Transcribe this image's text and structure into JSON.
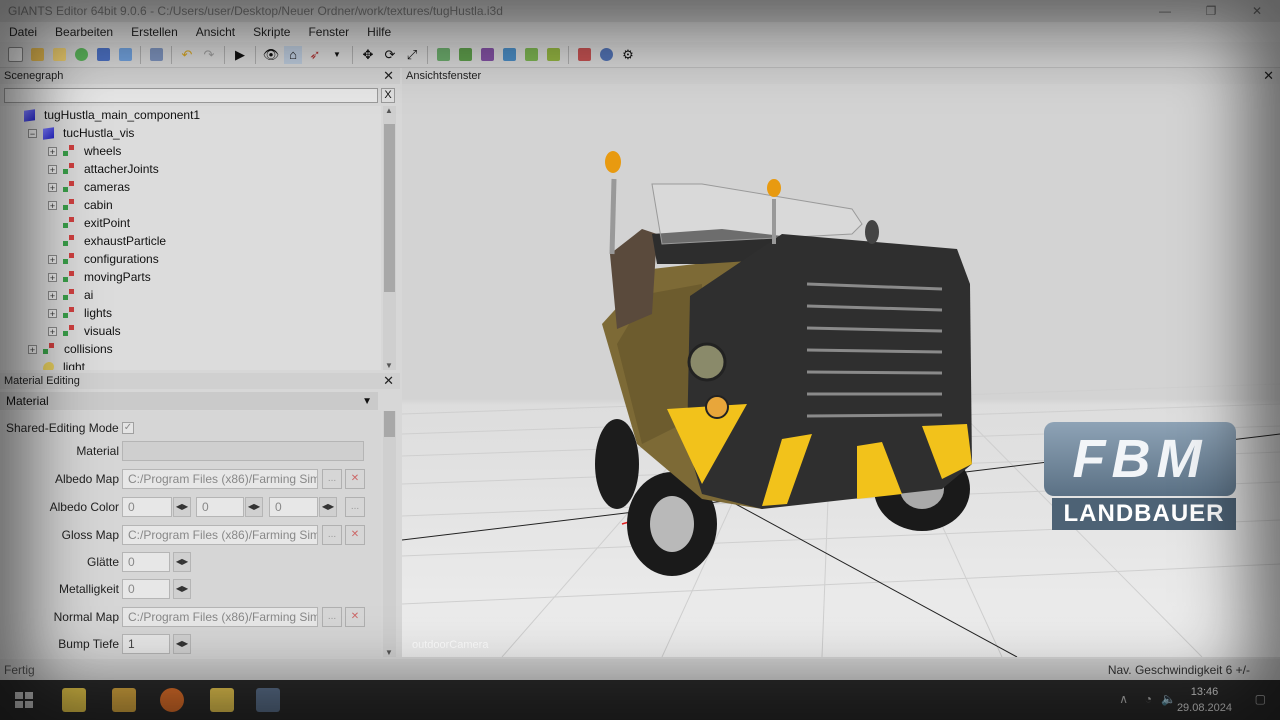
{
  "window": {
    "title": "GIANTS Editor 64bit 9.0.6 - C:/Users/user/Desktop/Neuer Ordner/work/textures/tugHustla.i3d",
    "controls": [
      "minimize",
      "restore",
      "close"
    ]
  },
  "menu": [
    "Datei",
    "Bearbeiten",
    "Erstellen",
    "Ansicht",
    "Skripte",
    "Fenster",
    "Hilfe"
  ],
  "toolbar": {
    "groups": [
      [
        "new-file-icon",
        "open-folder-icon",
        "edit-icon",
        "refresh-icon",
        "save-icon",
        "export-icon",
        "import-icon"
      ],
      [
        "undo-icon",
        "redo-icon"
      ],
      [
        "play-icon"
      ],
      [
        "eye-icon",
        "home-icon",
        "navigate-icon",
        "dropdown-icon"
      ],
      [
        "move-icon",
        "rotate-icon",
        "scale-icon"
      ],
      [
        "terrain-paint-icon",
        "terrain-sculpt-icon",
        "foliage-paint-icon",
        "foliage-erase-icon",
        "tree-icon",
        "tree-erase-icon"
      ],
      [
        "cube-icon",
        "shader-icon",
        "settings-icon"
      ]
    ]
  },
  "scenegraph": {
    "title": "Scenegraph",
    "close": "✕",
    "filter_clear": "X",
    "nodes": [
      {
        "label": "tugHustla_main_component1",
        "level": 0,
        "icon": "shape",
        "expander": ""
      },
      {
        "label": "tucHustla_vis",
        "level": 1,
        "icon": "shape",
        "expander": "−"
      },
      {
        "label": "wheels",
        "level": 2,
        "icon": "transformgroup",
        "expander": "+"
      },
      {
        "label": "attacherJoints",
        "level": 2,
        "icon": "transformgroup",
        "expander": "+"
      },
      {
        "label": "cameras",
        "level": 2,
        "icon": "transformgroup",
        "expander": "+"
      },
      {
        "label": "cabin",
        "level": 2,
        "icon": "transformgroup",
        "expander": "+"
      },
      {
        "label": "exitPoint",
        "level": 2,
        "icon": "transformgroup",
        "expander": ""
      },
      {
        "label": "exhaustParticle",
        "level": 2,
        "icon": "transformgroup",
        "expander": ""
      },
      {
        "label": "configurations",
        "level": 2,
        "icon": "transformgroup",
        "expander": "+"
      },
      {
        "label": "movingParts",
        "level": 2,
        "icon": "transformgroup",
        "expander": "+"
      },
      {
        "label": "ai",
        "level": 2,
        "icon": "transformgroup",
        "expander": "+"
      },
      {
        "label": "lights",
        "level": 2,
        "icon": "transformgroup",
        "expander": "+"
      },
      {
        "label": "visuals",
        "level": 2,
        "icon": "transformgroup",
        "expander": "+"
      },
      {
        "label": "collisions",
        "level": 1,
        "icon": "transformgroup",
        "expander": "+"
      },
      {
        "label": "light",
        "level": 1,
        "icon": "light",
        "expander": ""
      }
    ]
  },
  "material_editing": {
    "title": "Material Editing",
    "close": "✕",
    "dropdown": "Material",
    "shared_mode_label": "Shared-Editing Mode",
    "material_label": "Material",
    "albedo_map_label": "Albedo Map",
    "albedo_map_value": "C:/Program Files (x86)/Farming Sim",
    "albedo_color_label": "Albedo Color",
    "albedo_color_values": [
      "0",
      "0",
      "0"
    ],
    "gloss_map_label": "Gloss Map",
    "gloss_map_value": "C:/Program Files (x86)/Farming Sim",
    "glaette_label": "Glätte",
    "glaette_value": "0",
    "metallic_label": "Metalligkeit",
    "metallic_value": "0",
    "normal_map_label": "Normal Map",
    "normal_map_value": "C:/Program Files (x86)/Farming Sim",
    "bump_label": "Bump Tiefe",
    "bump_value": "1",
    "browse_label": "...",
    "clear_label": "✕"
  },
  "viewport": {
    "title": "Ansichtsfenster",
    "close": "✕",
    "camera": "outdoorCamera"
  },
  "logo": {
    "main": "FBM",
    "sub": "LANDBAUER"
  },
  "status": {
    "left": "Fertig",
    "right": "Nav. Geschwindigkeit 6 +/-"
  },
  "taskbar": {
    "time": "13:46",
    "date": "29.08.2024"
  },
  "colors": {
    "vehicle_body": "#7d6a36",
    "grille": "#2f2f2f",
    "hazard_yellow": "#f2c21b",
    "beacon": "#e89a10",
    "logo_blue": "#5b7185"
  }
}
